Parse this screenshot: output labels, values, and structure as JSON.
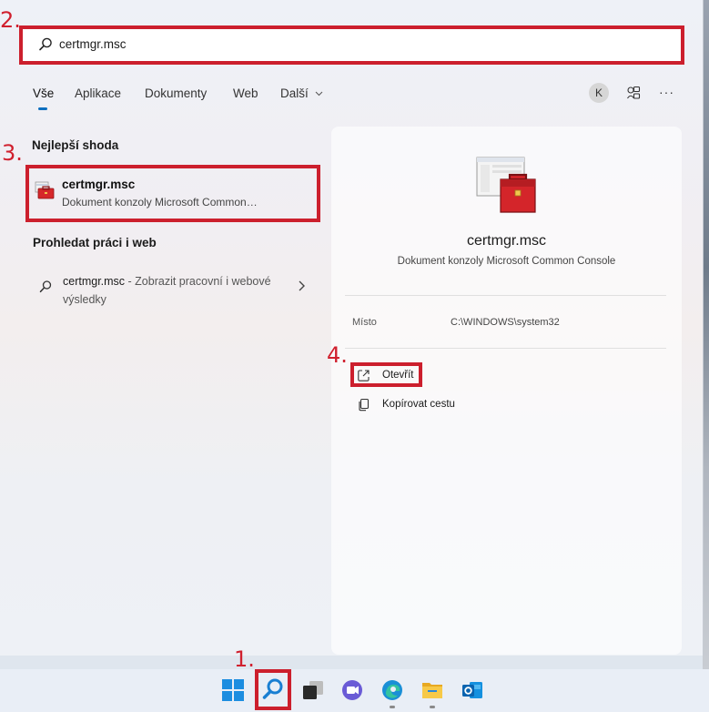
{
  "annotations": {
    "step1": "1.",
    "step2": "2.",
    "step3": "3.",
    "step4": "4."
  },
  "search": {
    "value": "certmgr.msc"
  },
  "tabs": [
    {
      "label": "Vše",
      "active": true
    },
    {
      "label": "Aplikace"
    },
    {
      "label": "Dokumenty"
    },
    {
      "label": "Web"
    },
    {
      "label": "Další"
    }
  ],
  "header": {
    "avatar_initial": "K",
    "more": "···"
  },
  "best_match": {
    "section_title": "Nejlepší shoda",
    "title": "certmgr.msc",
    "subtitle": "Dokument konzoly Microsoft Common…",
    "icon": "toolbox-icon"
  },
  "web_search": {
    "section_title": "Prohledat práci i web",
    "query": "certmgr.msc",
    "suffix": " - Zobrazit pracovní i webové výsledky"
  },
  "detail": {
    "name": "certmgr.msc",
    "type": "Dokument konzoly Microsoft Common Console",
    "location_label": "Místo",
    "location_value": "C:\\WINDOWS\\system32",
    "actions": [
      {
        "label": "Otevřít",
        "icon": "open-external-icon"
      },
      {
        "label": "Kopírovat cestu",
        "icon": "copy-icon"
      }
    ]
  },
  "colors": {
    "annotation_red": "#cc1f2d",
    "accent": "#0d6fbf"
  },
  "taskbar": [
    "windows-start-icon",
    "search-icon",
    "task-view-icon",
    "chat-icon",
    "edge-icon",
    "file-explorer-icon",
    "outlook-icon"
  ]
}
